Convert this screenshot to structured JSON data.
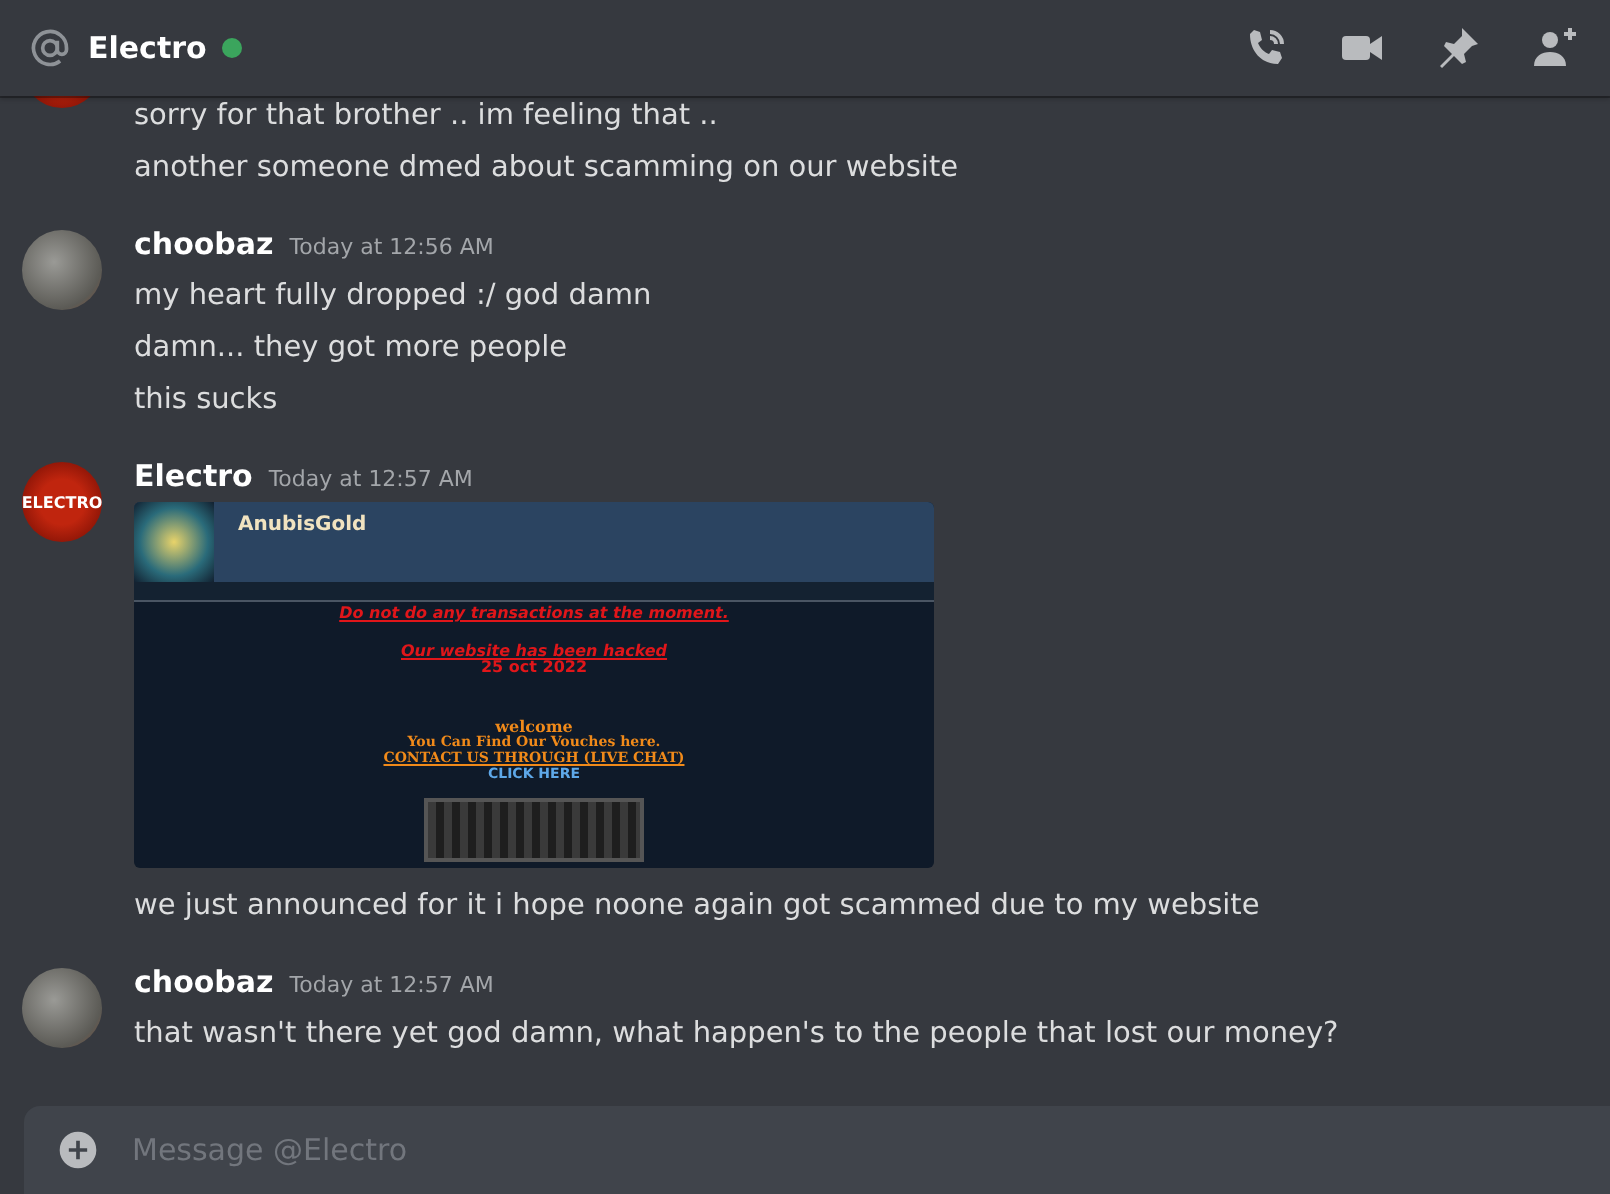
{
  "header": {
    "channel": "Electro",
    "online": true
  },
  "messages": [
    {
      "kind": "continued",
      "avatar": {
        "kind": "logo"
      },
      "lines": [
        "sorry for that brother .. im feeling that ..",
        "another someone dmed about scamming on our website"
      ]
    },
    {
      "kind": "group",
      "avatar": {
        "kind": "photo"
      },
      "author": "choobaz",
      "time": "Today at 12:56 AM",
      "lines": [
        "my heart fully dropped :/ god damn",
        "damn... they got more people",
        "this sucks"
      ]
    },
    {
      "kind": "group",
      "avatar": {
        "kind": "logo",
        "text": "ELECTRO"
      },
      "author": "Electro",
      "time": "Today at 12:57 AM",
      "attachment": {
        "site_name": "AnubisGold",
        "alert": "Do not do any transactions at the moment.",
        "hacked": "Our website has been hacked",
        "date": "25 oct 2022",
        "welcome": "welcome",
        "vouches": "You Can Find Our Vouches here.",
        "contact": "CONTACT US THROUGH (LIVE CHAT)",
        "click": "CLICK HERE"
      },
      "lines": [
        "we just announced for it i hope noone again got scammed due to my website"
      ]
    },
    {
      "kind": "group",
      "avatar": {
        "kind": "photo"
      },
      "author": "choobaz",
      "time": "Today at 12:57 AM",
      "lines": [
        "that wasn't there yet god damn, what happen's to the people that lost our money?"
      ]
    }
  ],
  "composer": {
    "placeholder": "Message @Electro"
  }
}
